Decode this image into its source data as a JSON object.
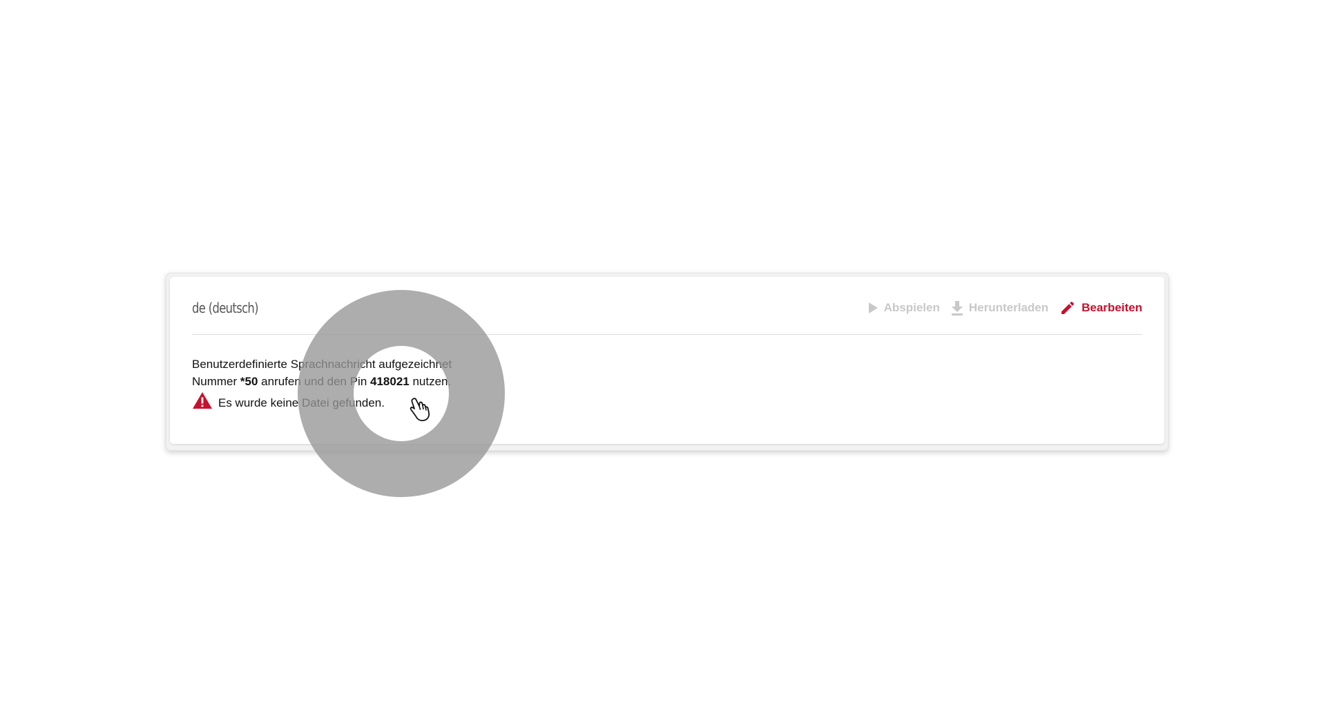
{
  "card": {
    "title": "de (deutsch)",
    "actions": {
      "play_label": "Abspielen",
      "download_label": "Herunterladen",
      "edit_label": "Bearbeiten"
    },
    "body": {
      "line1": "Benutzerdefinierte Sprachnachricht aufgezeichnet",
      "line2_prefix": "Nummer ",
      "number": "*50",
      "line2_middle": " anrufen und den Pin ",
      "pin": "418021",
      "line2_suffix": " nutzen.",
      "warning": "Es wurde keine Datei gefunden."
    }
  },
  "colors": {
    "accent": "#c8102e",
    "disabled": "#c8c8c8",
    "highlight_ring": "#969696"
  },
  "icons": {
    "play": "play-icon",
    "download": "download-icon",
    "edit": "pencil-icon",
    "warning": "warning-triangle-icon",
    "cursor": "hand-pointer-icon"
  }
}
